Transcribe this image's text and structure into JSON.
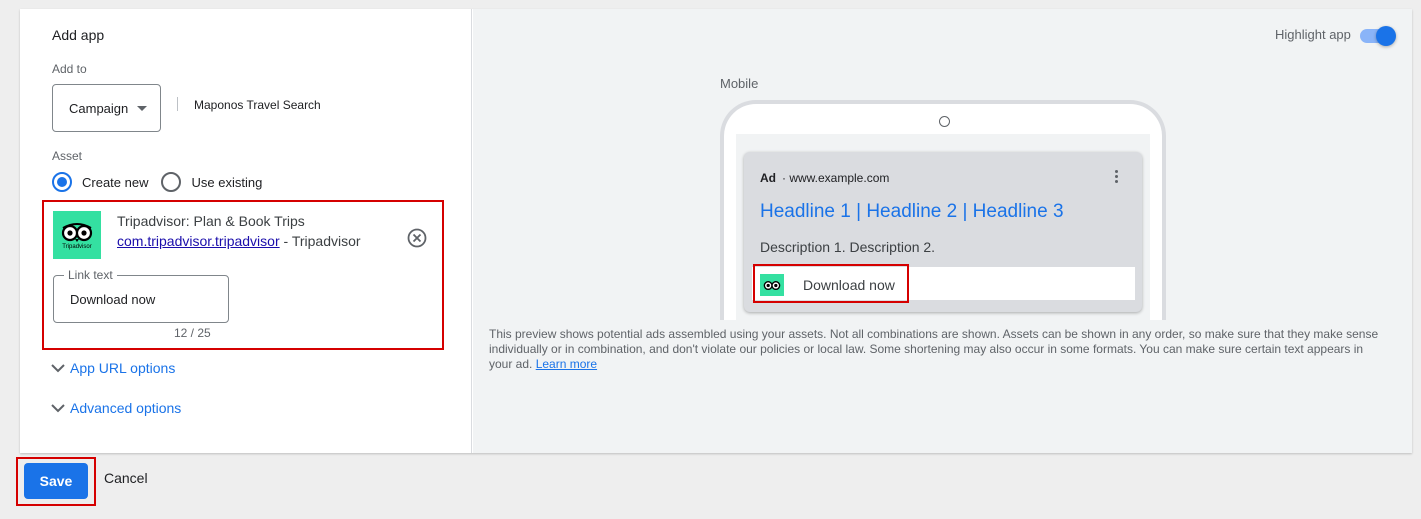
{
  "form": {
    "title": "Add app",
    "add_to_label": "Add to",
    "add_to_value": "Campaign",
    "campaign_name": "Maponos Travel Search",
    "asset_label": "Asset",
    "radio_create": "Create new",
    "radio_existing": "Use existing",
    "selected_radio": "Create new"
  },
  "app": {
    "name": "Tripadvisor: Plan & Book Trips",
    "package": "com.tripadvisor.tripadvisor",
    "publisher": "- Tripadvisor",
    "icon_text": "Tripadvisor",
    "icon_color": "#34e0a1"
  },
  "link_text": {
    "label": "Link text",
    "value": "Download now",
    "counter": "12 / 25"
  },
  "options": {
    "app_url": "App URL options",
    "advanced": "Advanced options"
  },
  "preview": {
    "highlight_label": "Highlight app",
    "highlight_on": true,
    "device_label": "Mobile",
    "ad_tag": "Ad",
    "ad_url": "· www.example.com",
    "headline": "Headline 1 | Headline 2 | Headline 3",
    "description": "Description 1. Description 2.",
    "cta": "Download now",
    "disclaimer": "This preview shows potential ads assembled using your assets. Not all combinations are shown. Assets can be shown in any order, so make sure that they make sense individually or in combination, and don't violate our policies or local law. Some shortening may also occur in some formats. You can make sure certain text appears in your ad.",
    "learn_more": "Learn more"
  },
  "footer": {
    "save": "Save",
    "cancel": "Cancel"
  },
  "colors": {
    "accent": "#1a73e8",
    "highlight_border": "#d50000"
  }
}
